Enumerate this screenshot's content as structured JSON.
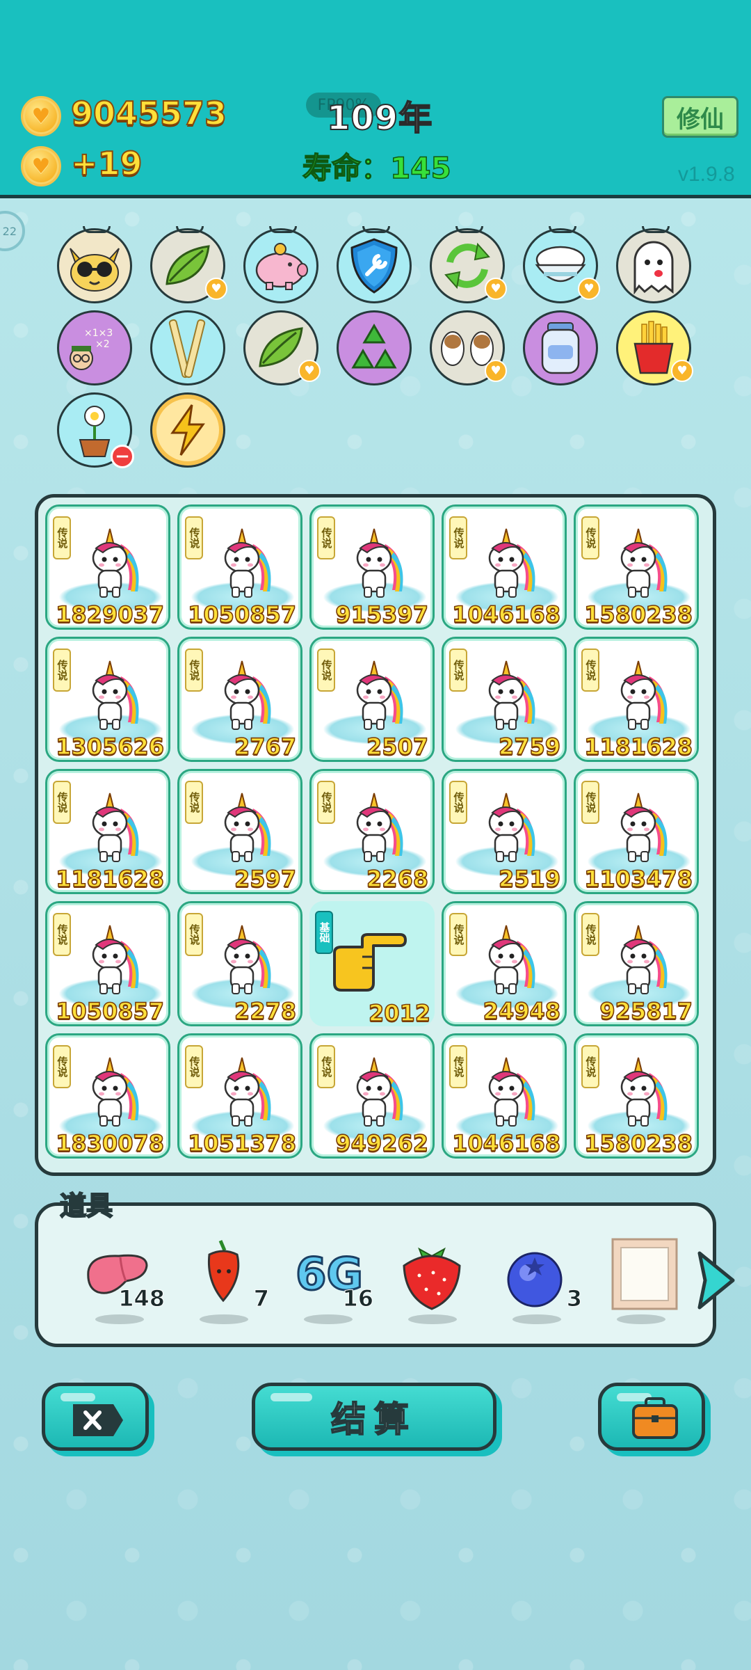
{
  "header": {
    "coins": "9045573",
    "income": "+19",
    "fps": "FP90%",
    "year": "109年",
    "lifespan": "寿命：145",
    "cultivate_label": "修仙",
    "version": "v1.9.8",
    "side_tab": "22"
  },
  "items": [
    {
      "name": "sunglasses-cat-icon",
      "bg": "#f2e7c8",
      "badge": "none"
    },
    {
      "name": "leaf-icon",
      "bg": "#e4e3d6",
      "badge": "heart"
    },
    {
      "name": "piggy-bank-icon",
      "bg": "#a9ecf3",
      "badge": "none"
    },
    {
      "name": "shield-wrench-icon",
      "bg": "#a9ecf3",
      "badge": "none"
    },
    {
      "name": "refresh-icon",
      "bg": "#e4e3d6",
      "badge": "heart"
    },
    {
      "name": "rice-bowl-icon",
      "bg": "#a9ecf3",
      "badge": "heart"
    },
    {
      "name": "ghost-icon",
      "bg": "#e4e3d6",
      "badge": "none"
    },
    {
      "name": "math-student-icon",
      "bg": "#c98ee0",
      "badge": "none"
    },
    {
      "name": "chopsticks-icon",
      "bg": "#a9ecf3",
      "badge": "none"
    },
    {
      "name": "leaf-icon",
      "bg": "#e4e3d6",
      "badge": "heart"
    },
    {
      "name": "recycle-icon",
      "bg": "#c98ee0",
      "badge": "none"
    },
    {
      "name": "twin-cows-icon",
      "bg": "#e4e3d6",
      "badge": "heart"
    },
    {
      "name": "milk-jar-icon",
      "bg": "#c98ee0",
      "badge": "none"
    },
    {
      "name": "fries-icon",
      "bg": "#fff27a",
      "badge": "heart"
    },
    {
      "name": "potted-flower-icon",
      "bg": "#a9ecf3",
      "badge": "minus"
    },
    {
      "name": "lightning-icon",
      "bg": "#ffe7a0",
      "badge": "none"
    }
  ],
  "board": {
    "legend_tag": "传说",
    "basic_tag": "基础",
    "cells": [
      {
        "value": "1829037",
        "type": "unicorn"
      },
      {
        "value": "1050857",
        "type": "unicorn"
      },
      {
        "value": "915397",
        "type": "unicorn"
      },
      {
        "value": "1046168",
        "type": "unicorn"
      },
      {
        "value": "1580238",
        "type": "unicorn"
      },
      {
        "value": "1305626",
        "type": "unicorn"
      },
      {
        "value": "2767",
        "type": "unicorn"
      },
      {
        "value": "2507",
        "type": "unicorn"
      },
      {
        "value": "2759",
        "type": "unicorn"
      },
      {
        "value": "1181628",
        "type": "unicorn"
      },
      {
        "value": "1181628",
        "type": "unicorn"
      },
      {
        "value": "2597",
        "type": "unicorn"
      },
      {
        "value": "2268",
        "type": "unicorn"
      },
      {
        "value": "2519",
        "type": "unicorn"
      },
      {
        "value": "1103478",
        "type": "unicorn"
      },
      {
        "value": "1050857",
        "type": "unicorn"
      },
      {
        "value": "2278",
        "type": "unicorn"
      },
      {
        "value": "2012",
        "type": "hand"
      },
      {
        "value": "24948",
        "type": "unicorn"
      },
      {
        "value": "925817",
        "type": "unicorn"
      },
      {
        "value": "1830078",
        "type": "unicorn"
      },
      {
        "value": "1051378",
        "type": "unicorn"
      },
      {
        "value": "949262",
        "type": "unicorn"
      },
      {
        "value": "1046168",
        "type": "unicorn"
      },
      {
        "value": "1580238",
        "type": "unicorn"
      }
    ]
  },
  "props": {
    "title": "道具",
    "list": [
      {
        "name": "liver-icon",
        "count": "148"
      },
      {
        "name": "chili-icon",
        "count": "7"
      },
      {
        "name": "6g-icon",
        "count": "16",
        "label": "6G"
      },
      {
        "name": "strawberry-icon",
        "count": ""
      },
      {
        "name": "blueberry-icon",
        "count": "3"
      },
      {
        "name": "frame-icon",
        "count": ""
      }
    ]
  },
  "bottom": {
    "settle_label": "结算"
  }
}
